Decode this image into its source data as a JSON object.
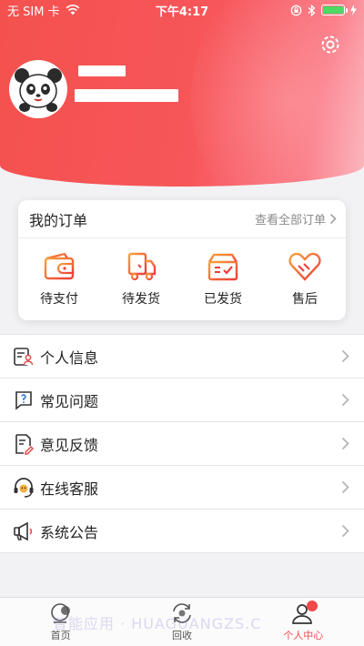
{
  "status_bar": {
    "carrier": "无 SIM 卡",
    "time": "下午4:17"
  },
  "orders": {
    "title": "我的订单",
    "view_all": "查看全部订单",
    "items": [
      {
        "label": "待支付",
        "icon": "wallet-icon"
      },
      {
        "label": "待发货",
        "icon": "truck-icon"
      },
      {
        "label": "已发货",
        "icon": "box-icon"
      },
      {
        "label": "售后",
        "icon": "aftersale-icon"
      }
    ]
  },
  "menu": [
    {
      "label": "个人信息",
      "icon": "profile-info-icon"
    },
    {
      "label": "常见问题",
      "icon": "faq-icon"
    },
    {
      "label": "意见反馈",
      "icon": "feedback-icon"
    },
    {
      "label": "在线客服",
      "icon": "headset-icon"
    },
    {
      "label": "系统公告",
      "icon": "megaphone-icon"
    }
  ],
  "tabs": [
    {
      "label": "首页",
      "icon": "home-icon",
      "active": false
    },
    {
      "label": "回收",
      "icon": "recycle-icon",
      "active": false
    },
    {
      "label": "个人中心",
      "icon": "user-icon",
      "active": true
    }
  ],
  "watermark": "智能应用 · HUAGUANGZS.C",
  "colors": {
    "accent": "#f24b4b",
    "header_start": "#f4514e",
    "header_end": "#fbb7be",
    "battery": "#4cd964"
  }
}
